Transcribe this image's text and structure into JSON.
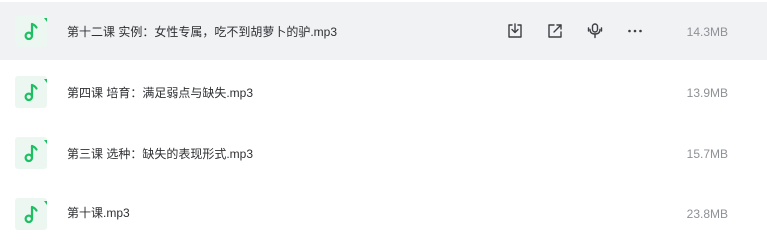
{
  "files": [
    {
      "name": "第十二课 实例：女性专属，吃不到胡萝卜的驴.mp3",
      "size": "14.3MB",
      "icon": "audio-file-icon",
      "hovered": true
    },
    {
      "name": "第四课 培育：满足弱点与缺失.mp3",
      "size": "13.9MB",
      "icon": "audio-file-icon",
      "hovered": false
    },
    {
      "name": "第三课 选种：缺失的表现形式.mp3",
      "size": "15.7MB",
      "icon": "audio-file-icon",
      "hovered": false
    },
    {
      "name": "第十课.mp3",
      "size": "23.8MB",
      "icon": "audio-file-icon",
      "hovered": false
    }
  ],
  "row_actions": [
    "download-icon",
    "share-icon",
    "podcast-icon",
    "more-icon"
  ],
  "colors": {
    "accent": "#1dbf63",
    "hover_bg": "#f1f2f4",
    "text": "#2f3033",
    "muted": "#8e9196"
  }
}
